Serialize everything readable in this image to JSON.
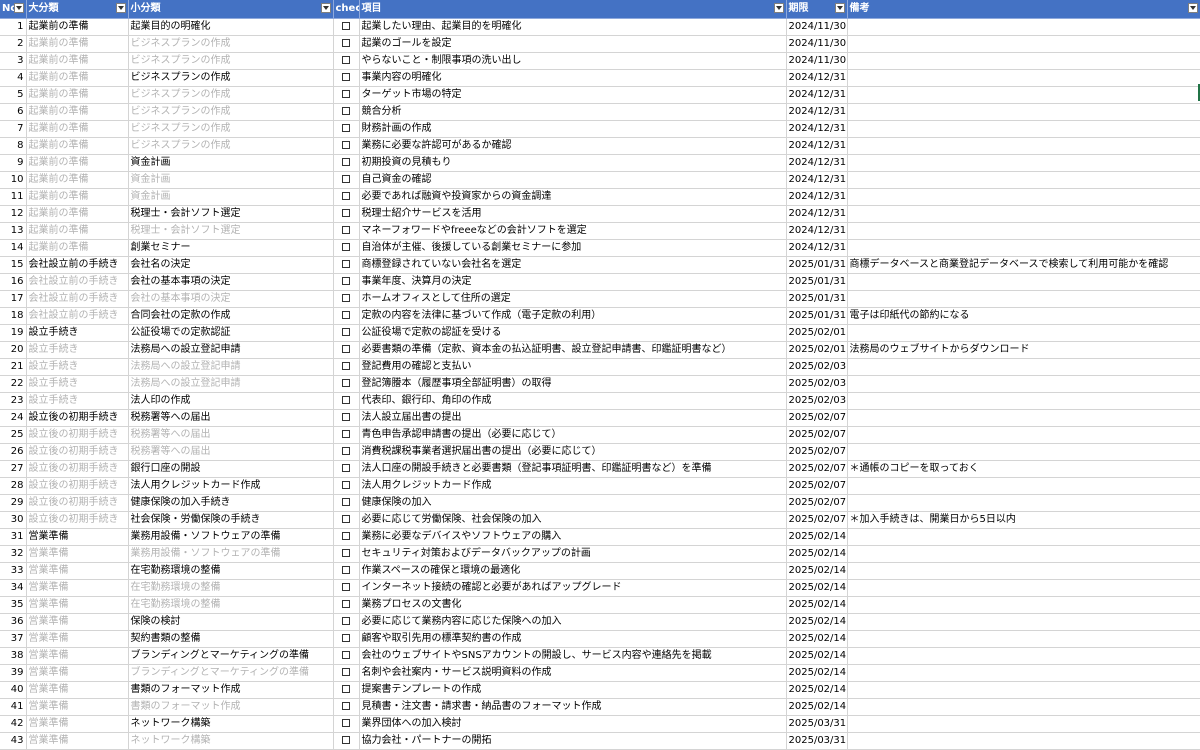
{
  "header": {
    "no": "No",
    "major": "大分類",
    "minor": "小分類",
    "check": "chec",
    "item": "項目",
    "deadline": "期限",
    "note": "備考"
  },
  "check_symbol": "☐",
  "colors": {
    "header_bg": "#4472c4",
    "dim_text": "#b3b3b3",
    "selection": "#217346"
  },
  "rows": [
    {
      "no": "1",
      "major": "起業前の準備",
      "major_dim": false,
      "minor": "起業目的の明確化",
      "minor_dim": false,
      "item": "起業したい理由、起業目的を明確化",
      "deadline": "2024/11/30",
      "note": ""
    },
    {
      "no": "2",
      "major": "起業前の準備",
      "major_dim": true,
      "minor": "ビジネスプランの作成",
      "minor_dim": true,
      "item": "起業のゴールを設定",
      "deadline": "2024/11/30",
      "note": ""
    },
    {
      "no": "3",
      "major": "起業前の準備",
      "major_dim": true,
      "minor": "ビジネスプランの作成",
      "minor_dim": true,
      "item": "やらないこと・制限事項の洗い出し",
      "deadline": "2024/11/30",
      "note": ""
    },
    {
      "no": "4",
      "major": "起業前の準備",
      "major_dim": true,
      "minor": "ビジネスプランの作成",
      "minor_dim": false,
      "item": "事業内容の明確化",
      "deadline": "2024/12/31",
      "note": ""
    },
    {
      "no": "5",
      "major": "起業前の準備",
      "major_dim": true,
      "minor": "ビジネスプランの作成",
      "minor_dim": true,
      "item": "ターゲット市場の特定",
      "deadline": "2024/12/31",
      "note": ""
    },
    {
      "no": "6",
      "major": "起業前の準備",
      "major_dim": true,
      "minor": "ビジネスプランの作成",
      "minor_dim": true,
      "item": "競合分析",
      "deadline": "2024/12/31",
      "note": ""
    },
    {
      "no": "7",
      "major": "起業前の準備",
      "major_dim": true,
      "minor": "ビジネスプランの作成",
      "minor_dim": true,
      "item": "財務計画の作成",
      "deadline": "2024/12/31",
      "note": ""
    },
    {
      "no": "8",
      "major": "起業前の準備",
      "major_dim": true,
      "minor": "ビジネスプランの作成",
      "minor_dim": true,
      "item": "業務に必要な許認可があるか確認",
      "deadline": "2024/12/31",
      "note": ""
    },
    {
      "no": "9",
      "major": "起業前の準備",
      "major_dim": true,
      "minor": "資金計画",
      "minor_dim": false,
      "item": "初期投資の見積もり",
      "deadline": "2024/12/31",
      "note": ""
    },
    {
      "no": "10",
      "major": "起業前の準備",
      "major_dim": true,
      "minor": "資金計画",
      "minor_dim": true,
      "item": "自己資金の確認",
      "deadline": "2024/12/31",
      "note": ""
    },
    {
      "no": "11",
      "major": "起業前の準備",
      "major_dim": true,
      "minor": "資金計画",
      "minor_dim": true,
      "item": "必要であれば融資や投資家からの資金調達",
      "deadline": "2024/12/31",
      "note": ""
    },
    {
      "no": "12",
      "major": "起業前の準備",
      "major_dim": true,
      "minor": "税理士・会計ソフト選定",
      "minor_dim": false,
      "item": "税理士紹介サービスを活用",
      "deadline": "2024/12/31",
      "note": ""
    },
    {
      "no": "13",
      "major": "起業前の準備",
      "major_dim": true,
      "minor": "税理士・会計ソフト選定",
      "minor_dim": true,
      "item": "マネーフォワードやfreeeなどの会計ソフトを選定",
      "deadline": "2024/12/31",
      "note": ""
    },
    {
      "no": "14",
      "major": "起業前の準備",
      "major_dim": true,
      "minor": "創業セミナー",
      "minor_dim": false,
      "item": "自治体が主催、後援している創業セミナーに参加",
      "deadline": "2024/12/31",
      "note": ""
    },
    {
      "no": "15",
      "major": "会社設立前の手続き",
      "major_dim": false,
      "minor": "会社名の決定",
      "minor_dim": false,
      "item": "商標登録されていない会社名を選定",
      "deadline": "2025/01/31",
      "note": "商標データベースと商業登記データベースで検索して利用可能かを確認"
    },
    {
      "no": "16",
      "major": "会社設立前の手続き",
      "major_dim": true,
      "minor": "会社の基本事項の決定",
      "minor_dim": false,
      "item": "事業年度、決算月の決定",
      "deadline": "2025/01/31",
      "note": ""
    },
    {
      "no": "17",
      "major": "会社設立前の手続き",
      "major_dim": true,
      "minor": "会社の基本事項の決定",
      "minor_dim": true,
      "item": "ホームオフィスとして住所の選定",
      "deadline": "2025/01/31",
      "note": ""
    },
    {
      "no": "18",
      "major": "会社設立前の手続き",
      "major_dim": true,
      "minor": "合同会社の定款の作成",
      "minor_dim": false,
      "item": "定款の内容を法律に基づいて作成（電子定款の利用）",
      "deadline": "2025/01/31",
      "note": "電子は印紙代の節約になる"
    },
    {
      "no": "19",
      "major": "設立手続き",
      "major_dim": false,
      "minor": "公証役場での定款認証",
      "minor_dim": false,
      "item": "公証役場で定款の認証を受ける",
      "deadline": "2025/02/01",
      "note": ""
    },
    {
      "no": "20",
      "major": "設立手続き",
      "major_dim": true,
      "minor": "法務局への設立登記申請",
      "minor_dim": false,
      "item": "必要書類の準備（定款、資本金の払込証明書、設立登記申請書、印鑑証明書など）",
      "deadline": "2025/02/01",
      "note": "法務局のウェブサイトからダウンロード"
    },
    {
      "no": "21",
      "major": "設立手続き",
      "major_dim": true,
      "minor": "法務局への設立登記申請",
      "minor_dim": true,
      "item": "登記費用の確認と支払い",
      "deadline": "2025/02/03",
      "note": ""
    },
    {
      "no": "22",
      "major": "設立手続き",
      "major_dim": true,
      "minor": "法務局への設立登記申請",
      "minor_dim": true,
      "item": "登記簿謄本（履歴事項全部証明書）の取得",
      "deadline": "2025/02/03",
      "note": ""
    },
    {
      "no": "23",
      "major": "設立手続き",
      "major_dim": true,
      "minor": "法人印の作成",
      "minor_dim": false,
      "item": "代表印、銀行印、角印の作成",
      "deadline": "2025/02/03",
      "note": ""
    },
    {
      "no": "24",
      "major": "設立後の初期手続き",
      "major_dim": false,
      "minor": "税務署等への届出",
      "minor_dim": false,
      "item": "法人設立届出書の提出",
      "deadline": "2025/02/07",
      "note": ""
    },
    {
      "no": "25",
      "major": "設立後の初期手続き",
      "major_dim": true,
      "minor": "税務署等への届出",
      "minor_dim": true,
      "item": "青色申告承認申請書の提出（必要に応じて）",
      "deadline": "2025/02/07",
      "note": ""
    },
    {
      "no": "26",
      "major": "設立後の初期手続き",
      "major_dim": true,
      "minor": "税務署等への届出",
      "minor_dim": true,
      "item": "消費税課税事業者選択届出書の提出（必要に応じて）",
      "deadline": "2025/02/07",
      "note": ""
    },
    {
      "no": "27",
      "major": "設立後の初期手続き",
      "major_dim": true,
      "minor": "銀行口座の開設",
      "minor_dim": false,
      "item": "法人口座の開設手続きと必要書類（登記事項証明書、印鑑証明書など）を準備",
      "deadline": "2025/02/07",
      "note": "＊通帳のコピーを取っておく"
    },
    {
      "no": "28",
      "major": "設立後の初期手続き",
      "major_dim": true,
      "minor": "法人用クレジットカード作成",
      "minor_dim": false,
      "item": "法人用クレジットカード作成",
      "deadline": "2025/02/07",
      "note": ""
    },
    {
      "no": "29",
      "major": "設立後の初期手続き",
      "major_dim": true,
      "minor": "健康保険の加入手続き",
      "minor_dim": false,
      "item": "健康保険の加入",
      "deadline": "2025/02/07",
      "note": ""
    },
    {
      "no": "30",
      "major": "設立後の初期手続き",
      "major_dim": true,
      "minor": "社会保険・労働保険の手続き",
      "minor_dim": false,
      "item": "必要に応じて労働保険、社会保険の加入",
      "deadline": "2025/02/07",
      "note": "＊加入手続きは、開業日から5日以内"
    },
    {
      "no": "31",
      "major": "営業準備",
      "major_dim": false,
      "minor": "業務用設備・ソフトウェアの準備",
      "minor_dim": false,
      "item": "業務に必要なデバイスやソフトウェアの購入",
      "deadline": "2025/02/14",
      "note": ""
    },
    {
      "no": "32",
      "major": "営業準備",
      "major_dim": true,
      "minor": "業務用設備・ソフトウェアの準備",
      "minor_dim": true,
      "item": "セキュリティ対策およびデータバックアップの計画",
      "deadline": "2025/02/14",
      "note": ""
    },
    {
      "no": "33",
      "major": "営業準備",
      "major_dim": true,
      "minor": "在宅勤務環境の整備",
      "minor_dim": false,
      "item": "作業スペースの確保と環境の最適化",
      "deadline": "2025/02/14",
      "note": ""
    },
    {
      "no": "34",
      "major": "営業準備",
      "major_dim": true,
      "minor": "在宅勤務環境の整備",
      "minor_dim": true,
      "item": "インターネット接続の確認と必要があればアップグレード",
      "deadline": "2025/02/14",
      "note": ""
    },
    {
      "no": "35",
      "major": "営業準備",
      "major_dim": true,
      "minor": "在宅勤務環境の整備",
      "minor_dim": true,
      "item": "業務プロセスの文書化",
      "deadline": "2025/02/14",
      "note": ""
    },
    {
      "no": "36",
      "major": "営業準備",
      "major_dim": true,
      "minor": "保険の検討",
      "minor_dim": false,
      "item": "必要に応じて業務内容に応じた保険への加入",
      "deadline": "2025/02/14",
      "note": ""
    },
    {
      "no": "37",
      "major": "営業準備",
      "major_dim": true,
      "minor": "契約書類の整備",
      "minor_dim": false,
      "item": "顧客や取引先用の標準契約書の作成",
      "deadline": "2025/02/14",
      "note": ""
    },
    {
      "no": "38",
      "major": "営業準備",
      "major_dim": true,
      "minor": "ブランディングとマーケティングの準備",
      "minor_dim": false,
      "item": "会社のウェブサイトやSNSアカウントの開設し、サービス内容や連絡先を掲載",
      "deadline": "2025/02/14",
      "note": ""
    },
    {
      "no": "39",
      "major": "営業準備",
      "major_dim": true,
      "minor": "ブランディングとマーケティングの準備",
      "minor_dim": true,
      "item": "名刺や会社案内・サービス説明資料の作成",
      "deadline": "2025/02/14",
      "note": ""
    },
    {
      "no": "40",
      "major": "営業準備",
      "major_dim": true,
      "minor": "書類のフォーマット作成",
      "minor_dim": false,
      "item": "提案書テンプレートの作成",
      "deadline": "2025/02/14",
      "note": ""
    },
    {
      "no": "41",
      "major": "営業準備",
      "major_dim": true,
      "minor": "書類のフォーマット作成",
      "minor_dim": true,
      "item": "見積書・注文書・請求書・納品書のフォーマット作成",
      "deadline": "2025/02/14",
      "note": ""
    },
    {
      "no": "42",
      "major": "営業準備",
      "major_dim": true,
      "minor": "ネットワーク構築",
      "minor_dim": false,
      "item": "業界団体への加入検討",
      "deadline": "2025/03/31",
      "note": ""
    },
    {
      "no": "43",
      "major": "営業準備",
      "major_dim": true,
      "minor": "ネットワーク構築",
      "minor_dim": true,
      "item": "協力会社・パートナーの開拓",
      "deadline": "2025/03/31",
      "note": ""
    }
  ]
}
